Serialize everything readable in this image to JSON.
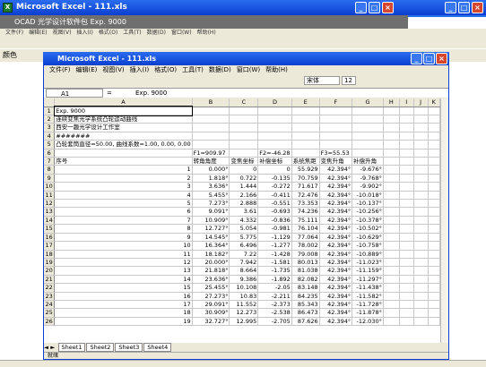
{
  "outer_window": {
    "title": "Microsoft Excel - 111.xls",
    "min": "_",
    "max": "□",
    "close": "×"
  },
  "ocad_bar": {
    "title": "OCAD 光学设计软件包   Exp. 9000"
  },
  "outer_menu": [
    "文件(F)",
    "编辑(E)",
    "视图(V)",
    "插入(I)",
    "格式(O)",
    "工具(T)",
    "数据(D)",
    "窗口(W)",
    "帮助(H)"
  ],
  "color_label": "颜色",
  "inner_window": {
    "title": "Microsoft Excel - 111.xls"
  },
  "inner_menu": [
    "文件(F)",
    "编辑(E)",
    "视图(V)",
    "插入(I)",
    "格式(O)",
    "工具(T)",
    "数据(D)",
    "窗口(W)",
    "帮助(H)"
  ],
  "toolbar": {
    "font": "宋体",
    "size": "12"
  },
  "formula": {
    "cell": "A1",
    "fx": "=",
    "value": "Exp. 9000"
  },
  "columns": [
    "A",
    "B",
    "C",
    "D",
    "E",
    "F",
    "G",
    "H",
    "I",
    "J",
    "K"
  ],
  "rows": [
    {
      "n": "1",
      "cells": [
        "Exp. 9000",
        "",
        "",
        "",
        "",
        "",
        "",
        ""
      ]
    },
    {
      "n": "2",
      "cells": [
        "连续变焦光学系统凸轮运动曲线",
        "",
        "",
        "",
        "",
        "",
        "",
        ""
      ]
    },
    {
      "n": "3",
      "cells": [
        "西安一趣光学设计工作室",
        "",
        "",
        "",
        "",
        "",
        "",
        ""
      ]
    },
    {
      "n": "4",
      "cells": [
        "#######",
        "",
        "",
        "",
        "",
        "",
        "",
        ""
      ]
    },
    {
      "n": "5",
      "cells": [
        "凸轮套筒直径=50.00, 曲线系数=1.00, 0.00, 0.00",
        "",
        "",
        "",
        "",
        "",
        "",
        ""
      ]
    },
    {
      "n": "6",
      "cells": [
        "",
        "F1=909.97",
        "",
        "F2=-46.28",
        "",
        "F3=55.53",
        "",
        ""
      ]
    },
    {
      "n": "7",
      "cells": [
        "序号",
        "转角角度",
        "变焦坐标",
        "补偿坐标",
        "系统焦距",
        "变焦升角",
        "补偿升角",
        ""
      ]
    },
    {
      "n": "8",
      "cells": [
        "1",
        "0.000°",
        "0",
        "0",
        "55.929",
        "42.394°",
        "-9.676°",
        ""
      ]
    },
    {
      "n": "9",
      "cells": [
        "2",
        "1.818°",
        "0.722",
        "-0.135",
        "70.759",
        "42.394°",
        "-9.768°",
        ""
      ]
    },
    {
      "n": "10",
      "cells": [
        "3",
        "3.636°",
        "1.444",
        "-0.272",
        "71.617",
        "42.394°",
        "-9.902°",
        ""
      ]
    },
    {
      "n": "11",
      "cells": [
        "4",
        "5.455°",
        "2.166",
        "-0.411",
        "72.476",
        "42.394°",
        "-10.018°",
        ""
      ]
    },
    {
      "n": "12",
      "cells": [
        "5",
        "7.273°",
        "2.888",
        "-0.551",
        "73.353",
        "42.394°",
        "-10.137°",
        ""
      ]
    },
    {
      "n": "13",
      "cells": [
        "6",
        "9.091°",
        "3.61",
        "-0.693",
        "74.236",
        "42.394°",
        "-10.256°",
        ""
      ]
    },
    {
      "n": "14",
      "cells": [
        "7",
        "10.909°",
        "4.332",
        "-0.836",
        "75.111",
        "42.394°",
        "-10.378°",
        ""
      ]
    },
    {
      "n": "15",
      "cells": [
        "8",
        "12.727°",
        "5.054",
        "-0.981",
        "76.104",
        "42.394°",
        "-10.502°",
        ""
      ]
    },
    {
      "n": "16",
      "cells": [
        "9",
        "14.545°",
        "5.775",
        "-1.129",
        "77.064",
        "42.394°",
        "-10.629°",
        ""
      ]
    },
    {
      "n": "17",
      "cells": [
        "10",
        "16.364°",
        "6.496",
        "-1.277",
        "78.002",
        "42.394°",
        "-10.758°",
        ""
      ]
    },
    {
      "n": "18",
      "cells": [
        "11",
        "18.182°",
        "7.22",
        "-1.428",
        "79.008",
        "42.394°",
        "-10.889°",
        ""
      ]
    },
    {
      "n": "19",
      "cells": [
        "12",
        "20.000°",
        "7.942",
        "-1.581",
        "80.013",
        "42.394°",
        "-11.023°",
        ""
      ]
    },
    {
      "n": "20",
      "cells": [
        "13",
        "21.818°",
        "8.664",
        "-1.735",
        "81.038",
        "42.394°",
        "-11.159°",
        ""
      ]
    },
    {
      "n": "21",
      "cells": [
        "14",
        "23.636°",
        "9.386",
        "-1.892",
        "82.082",
        "42.394°",
        "-11.297°",
        ""
      ]
    },
    {
      "n": "22",
      "cells": [
        "15",
        "25.455°",
        "10.108",
        "-2.05",
        "83.148",
        "42.394°",
        "-11.438°",
        ""
      ]
    },
    {
      "n": "23",
      "cells": [
        "16",
        "27.273°",
        "10.83",
        "-2.211",
        "84.235",
        "42.394°",
        "-11.582°",
        ""
      ]
    },
    {
      "n": "24",
      "cells": [
        "17",
        "29.091°",
        "11.552",
        "-2.373",
        "85.343",
        "42.394°",
        "-11.728°",
        ""
      ]
    },
    {
      "n": "25",
      "cells": [
        "18",
        "30.909°",
        "12.273",
        "-2.538",
        "86.473",
        "42.394°",
        "-11.878°",
        ""
      ]
    },
    {
      "n": "26",
      "cells": [
        "19",
        "32.727°",
        "12.995",
        "-2.705",
        "87.626",
        "42.394°",
        "-12.030°",
        ""
      ]
    }
  ],
  "sheet_tabs": [
    "Sheet1",
    "Sheet2",
    "Sheet3",
    "Sheet4"
  ],
  "status": "就绪"
}
